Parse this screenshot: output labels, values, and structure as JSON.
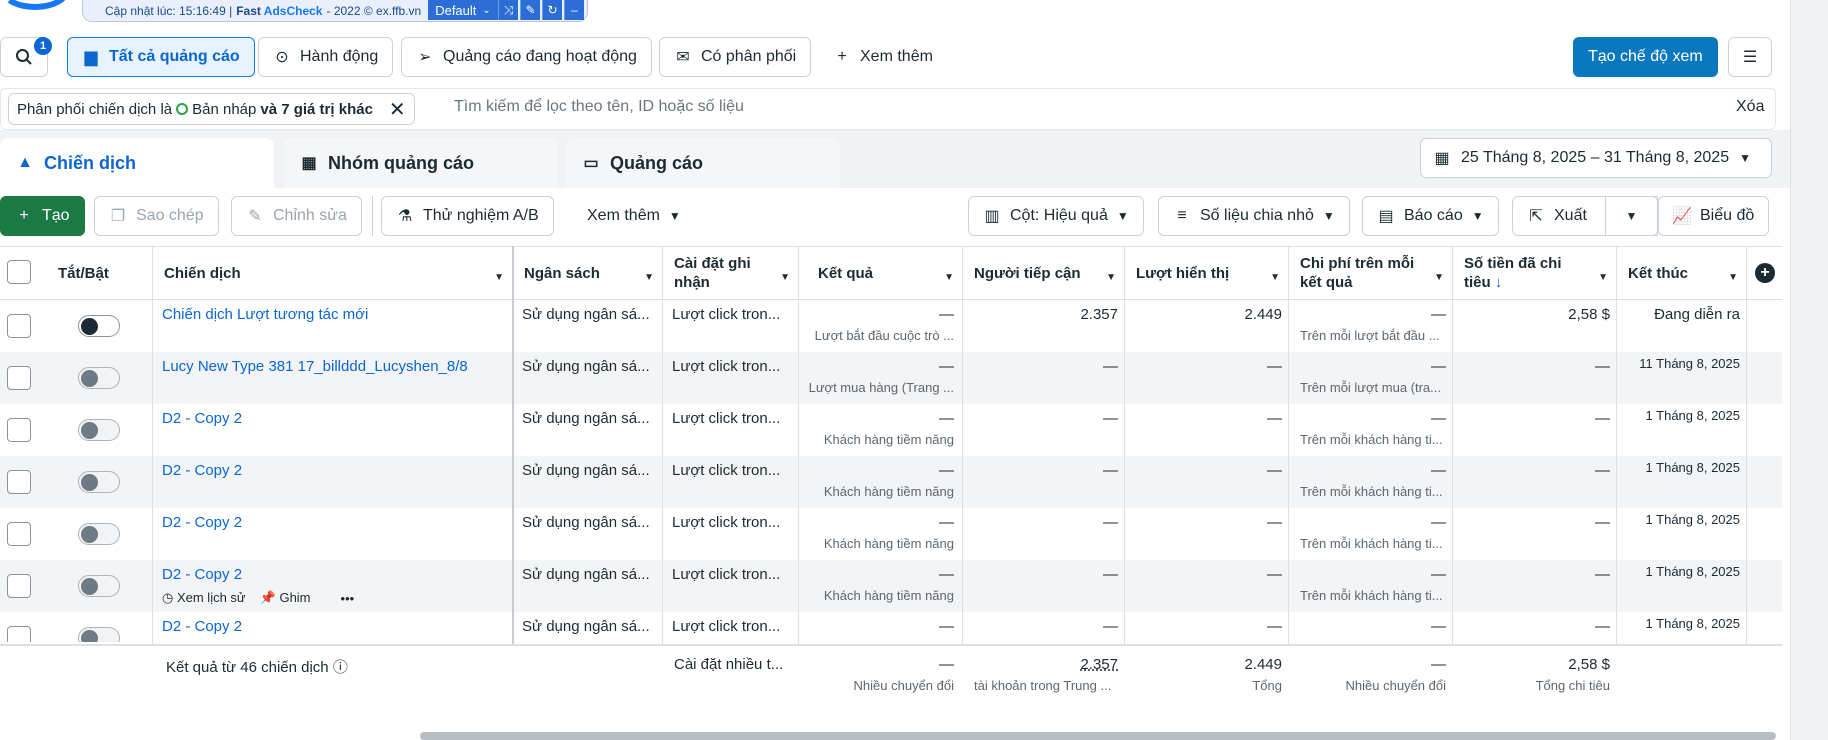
{
  "extension": {
    "updated": "Cập nhật lúc: 15:16:49 |",
    "fast": "Fast",
    "adscheck": "AdsCheck",
    "rest": "- 2022 © ex.ffb.vn",
    "default_label": "Default"
  },
  "toolbar": {
    "search_badge": "1",
    "all_ads": "Tất cả quảng cáo",
    "actions": "Hành động",
    "active_ads": "Quảng cáo đang hoạt động",
    "delivered": "Có phân phối",
    "see_more": "Xem thêm",
    "create_view": "Tạo chế độ xem"
  },
  "filter": {
    "chip_prefix": "Phân phối chiến dịch là",
    "chip_value": "Bản nháp",
    "chip_more": "và 7 giá trị khác",
    "search_placeholder": "Tìm kiếm để lọc theo tên, ID hoặc số liệu",
    "clear": "Xóa"
  },
  "tabs": [
    {
      "label": "Chiến dịch"
    },
    {
      "label": "Nhóm quảng cáo"
    },
    {
      "label": "Quảng cáo"
    }
  ],
  "date_range": "25 Tháng 8, 2025 – 31 Tháng 8, 2025",
  "actionbar": {
    "create": "Tạo",
    "copy": "Sao chép",
    "edit": "Chỉnh sửa",
    "ab_test": "Thử nghiệm A/B",
    "more": "Xem thêm",
    "columns": "Cột: Hiệu quả",
    "breakdown": "Số liệu chia nhỏ",
    "reports": "Báo cáo",
    "export": "Xuất",
    "chart": "Biểu đồ"
  },
  "columns": {
    "toggle": "Tắt/Bật",
    "campaign": "Chiến dịch",
    "budget": "Ngân sách",
    "attribution": "Cài đặt ghi nhận",
    "results": "Kết quả",
    "reach": "Người tiếp cận",
    "impressions": "Lượt hiển thị",
    "cost_per_result": "Chi phí trên mỗi kết quả",
    "amount_spent": "Số tiền đã chi tiêu",
    "amount_spent_arrow": "↓",
    "ends": "Kết thúc"
  },
  "rows": [
    {
      "name": "Chiến dịch Lượt tương tác mới",
      "budget": "Sử dụng ngân sá...",
      "attribution": "Lượt click tron...",
      "results": "—",
      "results_sub": "Lượt bắt đầu cuộc trò ...",
      "reach": "2.357",
      "impressions": "2.449",
      "cpr": "—",
      "cpr_sub": "Trên mỗi lượt bắt đầu ...",
      "spent": "2,58 $",
      "ends": "Đang diễn ra"
    },
    {
      "name": "Lucy New Type 381 17_billddd_Lucyshen_8/8",
      "budget": "Sử dụng ngân sá...",
      "attribution": "Lượt click tron...",
      "results": "—",
      "results_sub": "Lượt mua hàng (Trang ...",
      "reach": "—",
      "impressions": "—",
      "cpr": "—",
      "cpr_sub": "Trên mỗi lượt mua (tra...",
      "spent": "—",
      "ends": "11 Tháng 8, 2025"
    },
    {
      "name": "D2 - Copy 2",
      "budget": "Sử dụng ngân sá...",
      "attribution": "Lượt click tron...",
      "results": "—",
      "results_sub": "Khách hàng tiềm năng",
      "reach": "—",
      "impressions": "—",
      "cpr": "—",
      "cpr_sub": "Trên mỗi khách hàng ti...",
      "spent": "—",
      "ends": "1 Tháng 8, 2025"
    },
    {
      "name": "D2 - Copy 2",
      "budget": "Sử dụng ngân sá...",
      "attribution": "Lượt click tron...",
      "results": "—",
      "results_sub": "Khách hàng tiềm năng",
      "reach": "—",
      "impressions": "—",
      "cpr": "—",
      "cpr_sub": "Trên mỗi khách hàng ti...",
      "spent": "—",
      "ends": "1 Tháng 8, 2025"
    },
    {
      "name": "D2 - Copy 2",
      "budget": "Sử dụng ngân sá...",
      "attribution": "Lượt click tron...",
      "results": "—",
      "results_sub": "Khách hàng tiềm năng",
      "reach": "—",
      "impressions": "—",
      "cpr": "—",
      "cpr_sub": "Trên mỗi khách hàng ti...",
      "spent": "—",
      "ends": "1 Tháng 8, 2025"
    },
    {
      "name": "D2 - Copy 2",
      "budget": "Sử dụng ngân sá...",
      "attribution": "Lượt click tron...",
      "results": "—",
      "results_sub": "Khách hàng tiềm năng",
      "reach": "—",
      "impressions": "—",
      "cpr": "—",
      "cpr_sub": "Trên mỗi khách hàng ti...",
      "spent": "—",
      "ends": "1 Tháng 8, 2025"
    },
    {
      "name": "D2 - Copy 2",
      "budget": "Sử dụng ngân sá...",
      "attribution": "Lượt click tron...",
      "results": "—",
      "results_sub": "",
      "reach": "—",
      "impressions": "—",
      "cpr": "—",
      "cpr_sub": "",
      "spent": "—",
      "ends": "1 Tháng 8, 2025"
    }
  ],
  "row_actions": {
    "history": "Xem lịch sử",
    "pin": "Ghim",
    "more": "•••"
  },
  "footer": {
    "summary": "Kết quả từ 46 chiến dịch",
    "attribution": "Cài đặt nhiều t...",
    "results": "—",
    "results_sub": "Nhiều chuyển đổi",
    "reach": "2.357",
    "reach_sub": "tài khoản trong Trung ...",
    "impressions": "2.449",
    "impressions_sub": "Tổng",
    "cpr": "—",
    "cpr_sub": "Nhiều chuyển đổi",
    "spent": "2,58 $",
    "spent_sub": "Tổng chi tiêu"
  }
}
